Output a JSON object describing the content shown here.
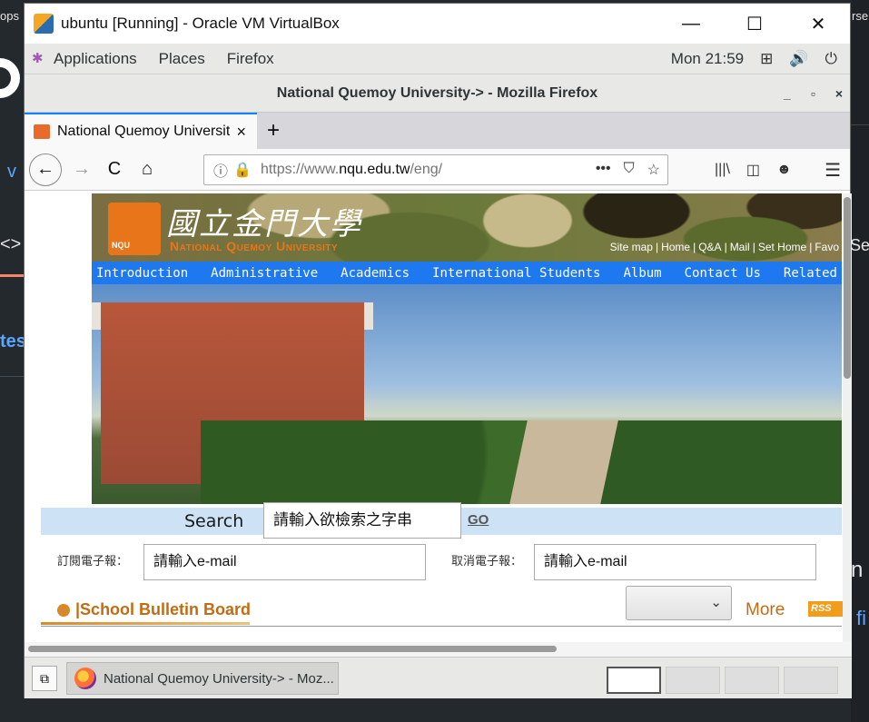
{
  "background": {
    "left_top": "ops",
    "right_top": "rse",
    "left_v": "v",
    "left_code": "<>",
    "left_tes": "tes",
    "right_se": "Se",
    "right_n": "n",
    "right_fi": "fi"
  },
  "vbox": {
    "title": "ubuntu [Running] - Oracle VM VirtualBox",
    "minimize": "—",
    "maximize": "☐",
    "close": "✕"
  },
  "gnome_panel": {
    "applications": "Applications",
    "places": "Places",
    "firefox": "Firefox",
    "clock": "Mon 21:59",
    "network_icon": "⊞",
    "volume_icon": "🔊",
    "power_icon": "⏻"
  },
  "firefox": {
    "window_title": "National Quemoy University-> - Mozilla Firefox",
    "win_min": "_",
    "win_max": "▫",
    "win_close": "×",
    "tab_label": "National Quemoy University->",
    "tab_close": "×",
    "new_tab": "+",
    "back": "←",
    "forward": "→",
    "reload": "C",
    "home": "⌂",
    "url_prefix": "https://www.",
    "url_domain": "nqu.edu.tw",
    "url_path": "/eng/",
    "page_actions": "•••",
    "pocket": "⛉",
    "bookmark": "☆",
    "library": "|||\\",
    "sidebar": "◫",
    "account": "☻",
    "menu": "☰"
  },
  "page": {
    "logo_text": "NQU",
    "title_cn": "國立金門大學",
    "title_en": "National Quemoy University",
    "quick_links": [
      "Site map",
      "Home",
      "Q&A",
      "Mail",
      "Set Home",
      "Favo"
    ],
    "nav": [
      "Introduction",
      "Administrative",
      "Academics",
      "International Students",
      "Album",
      "Contact Us",
      "Related Links"
    ],
    "search_label": "Search",
    "search_placeholder": "請輸入欲檢索之字串",
    "search_go": "GO",
    "subscribe_label": "訂閱電子報：",
    "subscribe_placeholder": "請輸入e-mail",
    "unsubscribe_label": "取消電子報：",
    "unsubscribe_placeholder": "請輸入e-mail",
    "bulletin": "School Bulletin Board",
    "select_chevron": "⌄",
    "more": "More",
    "rss": "RSS"
  },
  "taskbar": {
    "desktop_icon": "⧉",
    "task_label": "National Quemoy University-> - Moz..."
  }
}
